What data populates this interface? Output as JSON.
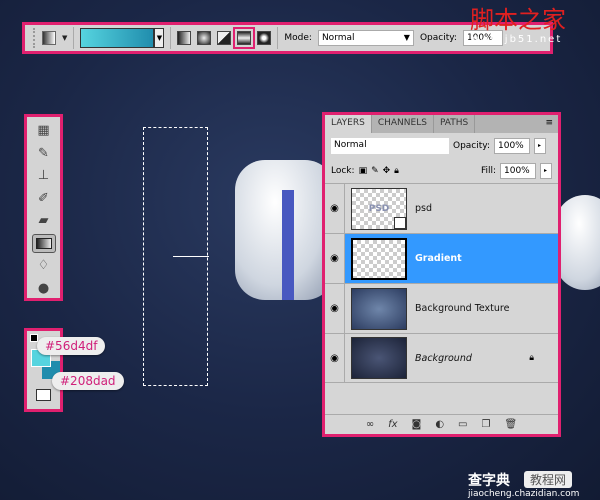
{
  "options_bar": {
    "mode_label": "Mode:",
    "mode_value": "Normal",
    "opacity_label": "Opacity:",
    "opacity_value": "100%",
    "gradient_types": [
      "linear",
      "radial",
      "angle",
      "reflected",
      "diamond"
    ],
    "selected_gradient_type": "reflected"
  },
  "toolbox": {
    "tools": [
      "marquee-icon",
      "brush-icon",
      "stamp-icon",
      "history-brush-icon",
      "eraser-icon",
      "gradient-icon",
      "blur-icon",
      "dodge-icon"
    ],
    "active": "gradient-icon"
  },
  "colors": {
    "foreground": "#56d4df",
    "background": "#208dad",
    "foreground_label": "#56d4df",
    "background_label": "#208dad",
    "accent": "#e0206f"
  },
  "layers_panel": {
    "tabs": [
      "LAYERS",
      "CHANNELS",
      "PATHS"
    ],
    "blend_mode": "Normal",
    "opacity_label": "Opacity:",
    "opacity_value": "100%",
    "lock_label": "Lock:",
    "fill_label": "Fill:",
    "fill_value": "100%",
    "layers": [
      {
        "name": "psd",
        "thumb_text": "PSD"
      },
      {
        "name": "Gradient",
        "selected": true
      },
      {
        "name": "Background Texture"
      },
      {
        "name": "Background",
        "locked": true
      }
    ]
  },
  "watermarks": {
    "top_cn": "脚本之家",
    "top_url": "www.jb51.net",
    "bottom_cn": "查字典",
    "bottom_badge": "教程网",
    "bottom_url": "jiaocheng.chazidian.com"
  }
}
